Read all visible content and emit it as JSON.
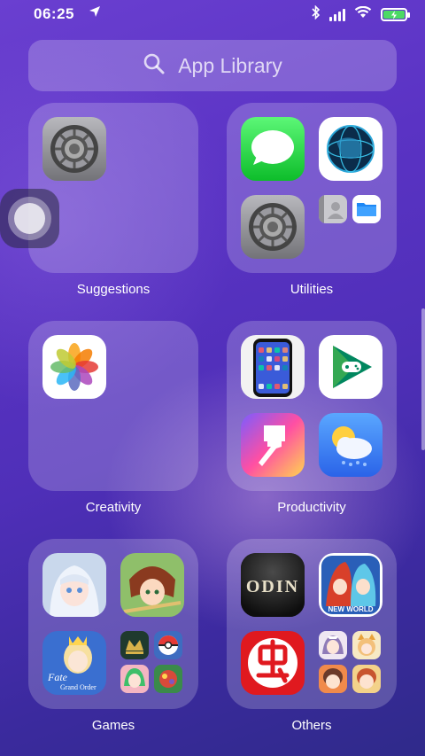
{
  "status_bar": {
    "time": "06:25"
  },
  "search": {
    "placeholder": "App Library"
  },
  "folders": [
    {
      "label": "Suggestions",
      "apps": [
        "settings-icon"
      ]
    },
    {
      "label": "Utilities",
      "apps": [
        "messages-icon",
        "globe-app-icon",
        "settings-icon",
        "contacts-icon",
        "files-icon"
      ]
    },
    {
      "label": "Creativity",
      "apps": [
        "photos-icon"
      ]
    },
    {
      "label": "Productivity",
      "apps": [
        "screen-mirror-icon",
        "play-games-icon",
        "paint-brush-icon",
        "weather-icon"
      ]
    },
    {
      "label": "Games",
      "apps": [
        "anime-girl-game-icon",
        "warrior-girl-game-icon",
        "fate-grand-order-icon",
        "gwent-icon",
        "pokeball-icon",
        "green-hair-game-icon",
        "bug-game-icon"
      ]
    },
    {
      "label": "Others",
      "apps": [
        "odin-icon",
        "new-world-icon",
        "red-char-app-icon",
        "maid-game-icon",
        "fox-game-icon",
        "chibi-game-icon",
        "chibi-game-2-icon"
      ]
    }
  ],
  "icon_text": {
    "odin": "ODIN",
    "new_world": "NEW WORLD"
  },
  "colors": {
    "messages": "#34c759",
    "files": "#1e88f5",
    "battery": "#4cd964"
  }
}
